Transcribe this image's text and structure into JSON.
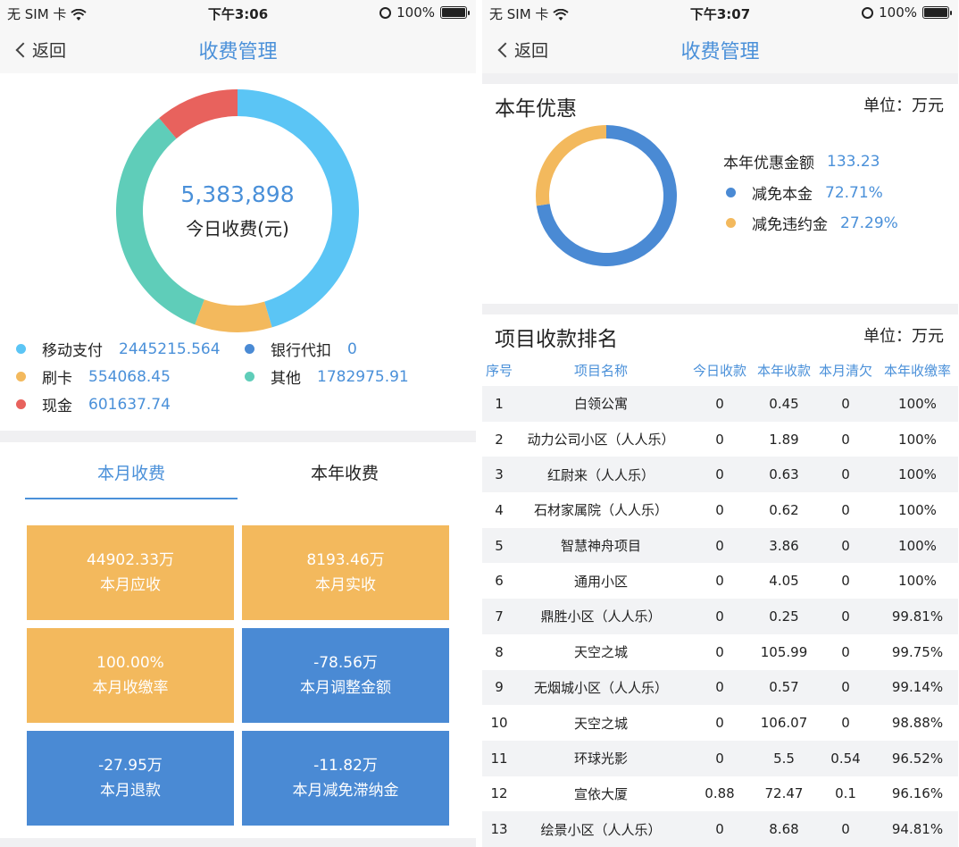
{
  "left": {
    "status": {
      "carrier": "无 SIM 卡",
      "time": "下午3:06",
      "battery": "100%"
    },
    "nav": {
      "back": "返回",
      "title": "收费管理"
    },
    "donut": {
      "value": "5,383,898",
      "label": "今日收费(元)",
      "segments": [
        {
          "name": "移动支付",
          "value": 2445215.564,
          "color": "#5bc5f5"
        },
        {
          "name": "银行代扣",
          "value": 0,
          "color": "#4a8ad4"
        },
        {
          "name": "刷卡",
          "value": 554068.45,
          "color": "#f3b95d"
        },
        {
          "name": "其他",
          "value": 1782975.91,
          "color": "#5fcdb9"
        },
        {
          "name": "现金",
          "value": 601637.74,
          "color": "#e8625d"
        }
      ]
    },
    "legend": [
      {
        "name": "移动支付",
        "value": "2445215.564",
        "color": "#5bc5f5"
      },
      {
        "name": "银行代扣",
        "value": "0",
        "color": "#4a8ad4"
      },
      {
        "name": "刷卡",
        "value": "554068.45",
        "color": "#f3b95d"
      },
      {
        "name": "其他",
        "value": "1782975.91",
        "color": "#5fcdb9"
      },
      {
        "name": "现金",
        "value": "601637.74",
        "color": "#e8625d"
      }
    ],
    "tabs": [
      {
        "label": "本月收费",
        "active": true
      },
      {
        "label": "本年收费",
        "active": false
      }
    ],
    "tiles": [
      {
        "value": "44902.33万",
        "label": "本月应收",
        "color": "yellow"
      },
      {
        "value": "8193.46万",
        "label": "本月实收",
        "color": "yellow"
      },
      {
        "value": "100.00%",
        "label": "本月收缴率",
        "color": "yellow"
      },
      {
        "value": "-78.56万",
        "label": "本月调整金额",
        "color": "blue"
      },
      {
        "value": "-27.95万",
        "label": "本月退款",
        "color": "blue"
      },
      {
        "value": "-11.82万",
        "label": "本月减免滞纳金",
        "color": "blue"
      }
    ]
  },
  "right": {
    "status": {
      "carrier": "无 SIM 卡",
      "time": "下午3:07",
      "battery": "100%"
    },
    "nav": {
      "back": "返回",
      "title": "收费管理"
    },
    "discount": {
      "title": "本年优惠",
      "unit": "单位：万元",
      "total_label": "本年优惠金额",
      "total_value": "133.23",
      "items": [
        {
          "name": "减免本金",
          "value": "72.71%",
          "share": 0.7271,
          "color": "#4a8ad4"
        },
        {
          "name": "减免违约金",
          "value": "27.29%",
          "share": 0.2729,
          "color": "#f3b95d"
        }
      ]
    },
    "ranking": {
      "title": "项目收款排名",
      "unit": "单位：万元",
      "headers": [
        "序号",
        "项目名称",
        "今日收款",
        "本年收款",
        "本月清欠",
        "本年收缴率"
      ],
      "rows": [
        [
          "1",
          "白领公寓",
          "0",
          "0.45",
          "0",
          "100%"
        ],
        [
          "2",
          "动力公司小区（人人乐）",
          "0",
          "1.89",
          "0",
          "100%"
        ],
        [
          "3",
          "红尉来（人人乐）",
          "0",
          "0.63",
          "0",
          "100%"
        ],
        [
          "4",
          "石材家属院（人人乐）",
          "0",
          "0.62",
          "0",
          "100%"
        ],
        [
          "5",
          "智慧神舟项目",
          "0",
          "3.86",
          "0",
          "100%"
        ],
        [
          "6",
          "通用小区",
          "0",
          "4.05",
          "0",
          "100%"
        ],
        [
          "7",
          "鼎胜小区（人人乐）",
          "0",
          "0.25",
          "0",
          "99.81%"
        ],
        [
          "8",
          "天空之城",
          "0",
          "105.99",
          "0",
          "99.75%"
        ],
        [
          "9",
          "无烟城小区（人人乐）",
          "0",
          "0.57",
          "0",
          "99.14%"
        ],
        [
          "10",
          "天空之城",
          "0",
          "106.07",
          "0",
          "98.88%"
        ],
        [
          "11",
          "环球光影",
          "0",
          "5.5",
          "0.54",
          "96.52%"
        ],
        [
          "12",
          "宣依大厦",
          "0.88",
          "72.47",
          "0.1",
          "96.16%"
        ],
        [
          "13",
          "绘景小区（人人乐）",
          "0",
          "8.68",
          "0",
          "94.81%"
        ]
      ]
    }
  }
}
